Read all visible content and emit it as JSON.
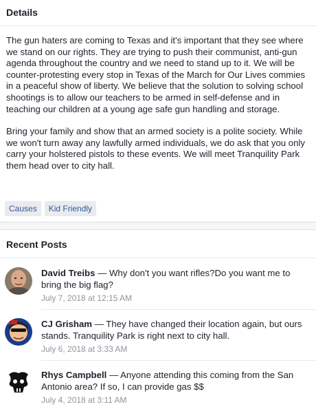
{
  "details": {
    "title": "Details",
    "paragraphs": [
      "The gun haters are coming to Texas and it's important that they see where we stand on our rights. They are trying to push their communist, anti-gun agenda throughout the country and we need to stand up to it. We will be counter-protesting every stop in Texas of the March for Our Lives commies in a peaceful show of liberty. We believe that the solution to solving school shootings is to allow our teachers to be armed in self-defense and in teaching our children at a young age safe gun handling and storage.",
      "Bring your family and show that an armed society is a polite society. While we won't turn away any lawfully armed individuals, we do ask that you only carry your holstered pistols to these events. We will meet Tranquility Park them head over to city hall."
    ],
    "tags": [
      "Causes",
      "Kid Friendly"
    ]
  },
  "recent_posts": {
    "title": "Recent Posts",
    "posts": [
      {
        "author": "David Treibs",
        "text": " — Why don't you want rifles?Do you want me to bring the big flag?",
        "time": "July 7, 2018 at 12:15 AM",
        "avatar_icon": "bald-man-avatar-icon"
      },
      {
        "author": "CJ Grisham",
        "text": " — They have changed their location again, but ours stands. Tranquility Park is right next to city hall.",
        "time": "July 6, 2018 at 3:33 AM",
        "avatar_icon": "cartoon-avatar-icon"
      },
      {
        "author": "Rhys Campbell",
        "text": " — Anyone attending this coming from the San Antonio area? If so, I can provide gas $$",
        "time": "July 4, 2018 at 3:11 AM",
        "avatar_icon": "skull-logo-avatar-icon"
      }
    ]
  },
  "colors": {
    "link": "#365899",
    "muted": "#90949c",
    "tag_bg": "#e9ebee"
  }
}
